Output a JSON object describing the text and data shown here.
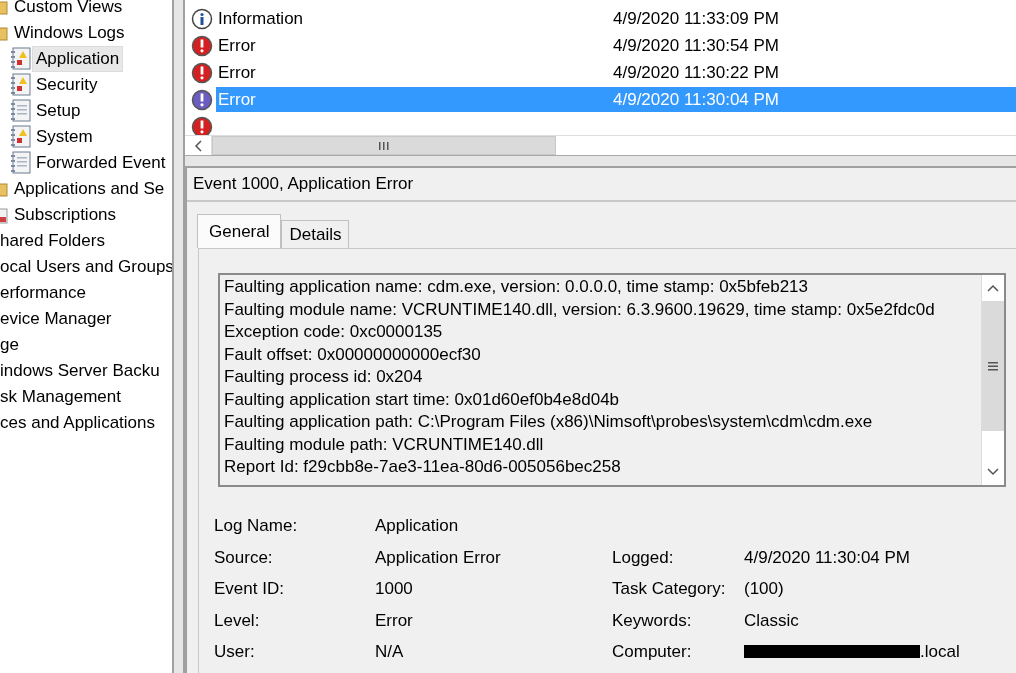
{
  "tree_inner": [
    {
      "label": "Custom Views",
      "kind": "folder"
    },
    {
      "label": "Windows Logs",
      "kind": "folder",
      "children": [
        {
          "label": "Application",
          "kind": "log",
          "selected": true
        },
        {
          "label": "Security",
          "kind": "log",
          "selected": false
        },
        {
          "label": "Setup",
          "kind": "plainlog",
          "selected": false
        },
        {
          "label": "System",
          "kind": "log",
          "selected": false
        },
        {
          "label": "Forwarded Event",
          "kind": "plainlog",
          "selected": false
        }
      ]
    },
    {
      "label": "Applications and Se",
      "kind": "folder"
    },
    {
      "label": "Subscriptions",
      "kind": "subs"
    }
  ],
  "tree_outer": [
    "hared Folders",
    "ocal Users and Groups",
    "erformance",
    "evice Manager",
    "ge",
    "indows Server Backu",
    "sk Management",
    "ces and Applications"
  ],
  "events": [
    {
      "kind": "information",
      "label": "Information",
      "date": "4/9/2020 11:33:09 PM",
      "selected": false
    },
    {
      "kind": "error",
      "label": "Error",
      "date": "4/9/2020 11:30:54 PM",
      "selected": false
    },
    {
      "kind": "error",
      "label": "Error",
      "date": "4/9/2020 11:30:22 PM",
      "selected": false
    },
    {
      "kind": "error",
      "label": "Error",
      "date": "4/9/2020 11:30:04 PM",
      "selected": true
    },
    {
      "kind": "error"
    }
  ],
  "detail": {
    "title": "Event 1000, Application Error",
    "tabs": [
      {
        "label": "General",
        "selected": true
      },
      {
        "label": "Details",
        "selected": false
      }
    ],
    "description": [
      "Faulting application name: cdm.exe, version: 0.0.0.0, time stamp: 0x5bfeb213",
      "Faulting module name: VCRUNTIME140.dll, version: 6.3.9600.19629, time stamp: 0x5e2fdc0d",
      "Exception code: 0xc0000135",
      "Fault offset: 0x00000000000ecf30",
      "Faulting process id: 0x204",
      "Faulting application start time: 0x01d60ef0b4e8d04b",
      "Faulting application path: C:\\Program Files (x86)\\Nimsoft\\probes\\system\\cdm\\cdm.exe",
      "Faulting module path: VCRUNTIME140.dll",
      "Report Id: f29cbb8e-7ae3-11ea-80d6-005056bec258"
    ],
    "fields": [
      [
        {
          "label": "Log Name:",
          "value": "Application"
        }
      ],
      [
        {
          "label": "Source:",
          "value": "Application Error"
        },
        {
          "label": "Logged:",
          "value": "4/9/2020 11:30:04 PM"
        }
      ],
      [
        {
          "label": "Event ID:",
          "value": "1000"
        },
        {
          "label": "Task Category:",
          "value": "(100)"
        }
      ],
      [
        {
          "label": "Level:",
          "value": "Error"
        },
        {
          "label": "Keywords:",
          "value": "Classic"
        }
      ],
      [
        {
          "label": "User:",
          "value": "N/A"
        },
        {
          "label": "Computer:",
          "value": ".local",
          "redacted": true
        }
      ]
    ]
  }
}
